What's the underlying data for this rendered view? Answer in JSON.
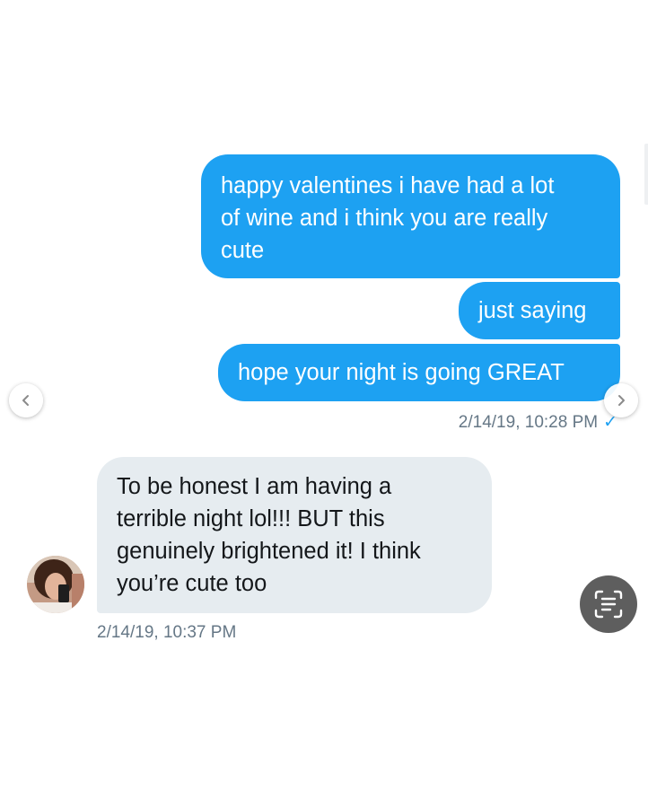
{
  "conversation": {
    "sent_messages": [
      {
        "lines": [
          "happy valentines i have had a lot",
          "of wine and i think you are really",
          "cute"
        ]
      },
      {
        "lines": [
          "just saying"
        ]
      },
      {
        "lines": [
          "hope your night is going GREAT"
        ]
      }
    ],
    "sent_timestamp": "2/14/19, 10:28 PM",
    "sent_status_icon": "checkmark-icon",
    "received_message": {
      "lines": [
        "To be honest I am having a",
        "terrible night lol!!! BUT this",
        "genuinely brightened it! I think",
        "you’re cute too"
      ]
    },
    "received_timestamp": "2/14/19, 10:37 PM"
  },
  "controls": {
    "prev_icon": "chevron-left-icon",
    "next_icon": "chevron-right-icon",
    "scan_icon": "text-scan-icon"
  },
  "colors": {
    "sent_bubble": "#1da1f2",
    "received_bubble": "#e6ecf0",
    "timestamp": "#657786",
    "checkmark": "#1da1f2"
  }
}
